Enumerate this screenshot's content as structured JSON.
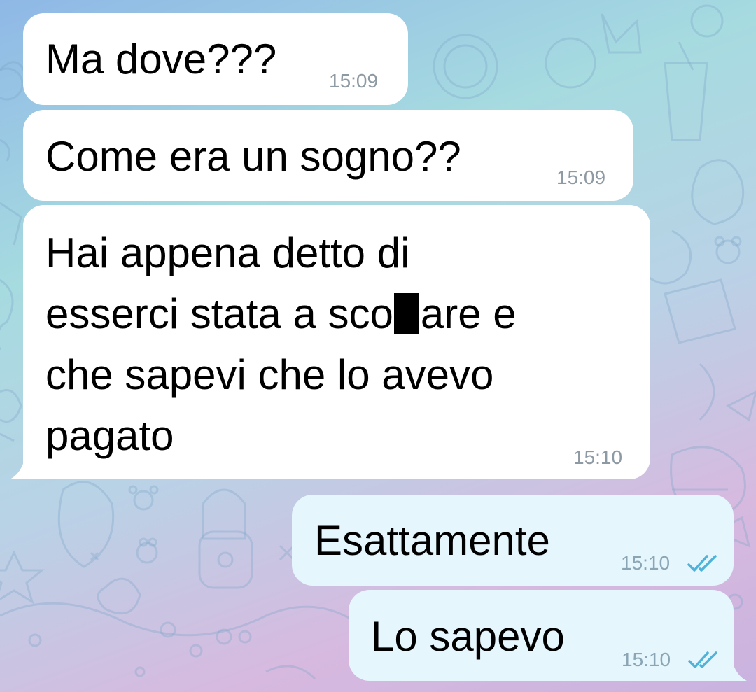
{
  "colors": {
    "incoming_bubble": "#ffffff",
    "outgoing_bubble": "#e6f6fd",
    "timestamp": "#8e9aa3",
    "read_check": "#4fb3d9",
    "background_from": "#8fb8e6",
    "background_to": "#d7b9df"
  },
  "messages": [
    {
      "direction": "incoming",
      "text": "Ma dove???",
      "time": "15:09"
    },
    {
      "direction": "incoming",
      "text": "Come era un sogno??",
      "time": "15:09"
    },
    {
      "direction": "incoming",
      "lines": [
        "Hai appena detto di",
        "esserci stata a sco",
        "are e",
        "che sapevi che lo avevo",
        "pagato"
      ],
      "redacted": true,
      "time": "15:10"
    },
    {
      "direction": "outgoing",
      "text": "Esattamente",
      "time": "15:10",
      "status": "read",
      "status_icon": "double-check-icon"
    },
    {
      "direction": "outgoing",
      "text": "Lo sapevo",
      "time": "15:10",
      "status": "read",
      "status_icon": "double-check-icon"
    }
  ]
}
